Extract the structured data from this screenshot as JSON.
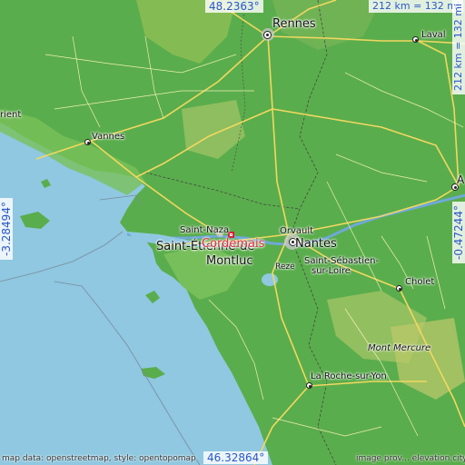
{
  "map": {
    "highlighted_place": "Cordemais",
    "colors": {
      "sea": "#8fc8e0",
      "land": "#5aad4c",
      "highland": "#b9c86a",
      "road": "#e8d56a",
      "marker": "#d2223a",
      "coords": "#2a57c8"
    }
  },
  "coords": {
    "top_lat": "48.2363°",
    "bottom_lat": "46.32864°",
    "left_lon": "-3.28494°",
    "right_lon": "-0.47244°",
    "scale_h": "212 km = 132 mi",
    "scale_v": "212 km = 132 mi"
  },
  "places": {
    "rennes": "Rennes",
    "laval": "Laval",
    "lorient": "rient",
    "vannes": "Vannes",
    "saint_nazaire": "Saint-Naza",
    "saint_etienne": "Saint-Étienne-de-",
    "montluc": "Montluc",
    "cordemais": "Cordemais",
    "orvault": "Orvault",
    "nantes": "Nantes",
    "reze": "Rezé",
    "saint_sebastien": "Saint-Sébastien-",
    "sur_loire": "sur-Loire",
    "cholet": "Cholet",
    "mont_mercure": "Mont Mercure",
    "la_roche": "La Roche-sur-Yon",
    "angers": "A"
  },
  "footer": {
    "left": "map data: openstreetmap, style: opentopomap",
    "right": "image prov... elevation.city"
  }
}
